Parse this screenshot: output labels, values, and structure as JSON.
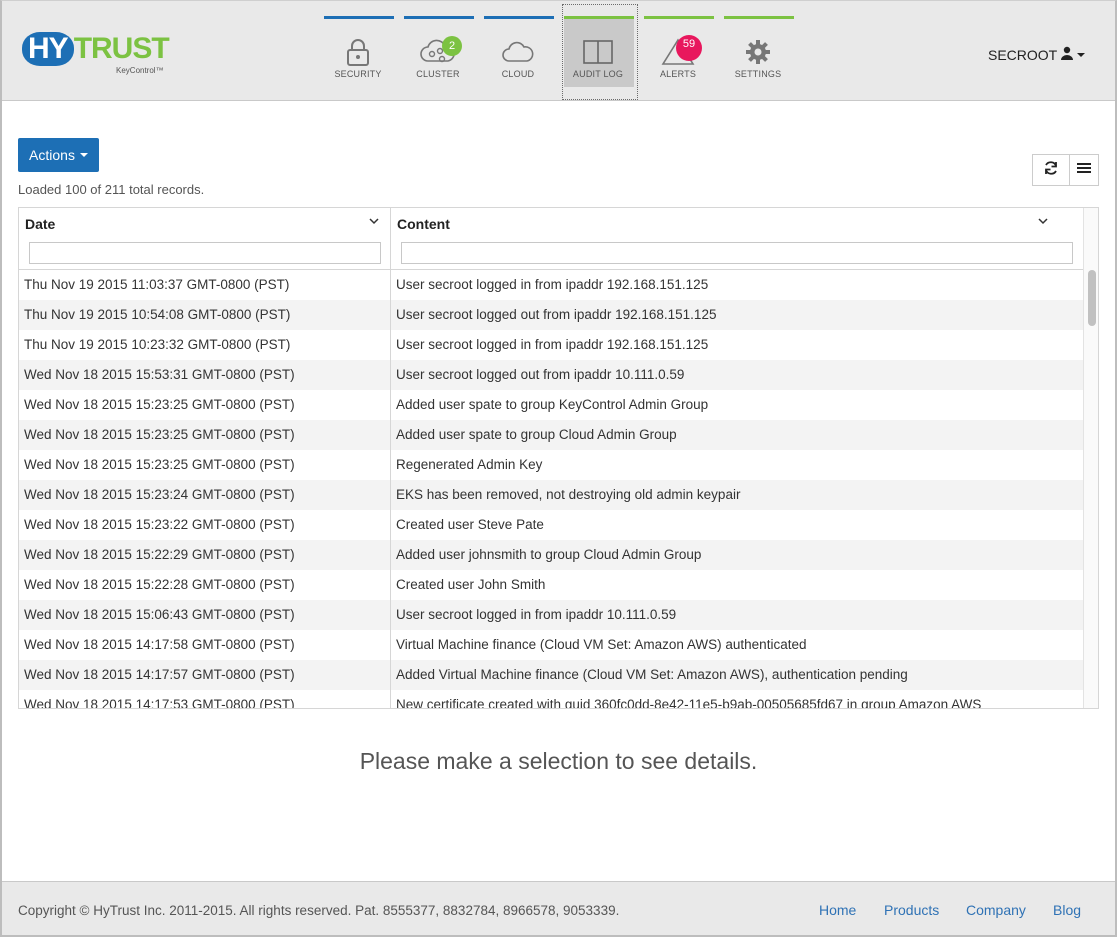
{
  "brand": {
    "main_a": "HY",
    "main_b": "TRUST",
    "sub": "KeyControl™"
  },
  "nav": {
    "items": [
      {
        "label": "SECURITY",
        "icon": "lock-icon",
        "bar_color": "#1d6fb5"
      },
      {
        "label": "CLUSTER",
        "icon": "cluster-icon",
        "bar_color": "#1d6fb5",
        "badge": "2",
        "badge_color": "#7cc242"
      },
      {
        "label": "CLOUD",
        "icon": "cloud-icon",
        "bar_color": "#1d6fb5"
      },
      {
        "label": "AUDIT LOG",
        "icon": "book-icon",
        "bar_color": "#7cc242",
        "active": true
      },
      {
        "label": "ALERTS",
        "icon": "alert-icon",
        "bar_color": "#7cc242",
        "badge": "59",
        "badge_color": "#e8175d"
      },
      {
        "label": "SETTINGS",
        "icon": "gear-icon",
        "bar_color": "#7cc242"
      }
    ]
  },
  "user": {
    "name": "SECROOT"
  },
  "toolbar": {
    "actions_label": "Actions",
    "record_count": "Loaded 100 of 211 total records."
  },
  "grid": {
    "columns": [
      {
        "title": "Date"
      },
      {
        "title": "Content"
      }
    ],
    "filters": {
      "date": "",
      "content": ""
    },
    "rows": [
      {
        "date": "Thu Nov 19 2015 11:03:37 GMT-0800 (PST)",
        "content": "User secroot logged in from ipaddr 192.168.151.125"
      },
      {
        "date": "Thu Nov 19 2015 10:54:08 GMT-0800 (PST)",
        "content": "User secroot logged out from ipaddr 192.168.151.125"
      },
      {
        "date": "Thu Nov 19 2015 10:23:32 GMT-0800 (PST)",
        "content": "User secroot logged in from ipaddr 192.168.151.125"
      },
      {
        "date": "Wed Nov 18 2015 15:53:31 GMT-0800 (PST)",
        "content": "User secroot logged out from ipaddr 10.111.0.59"
      },
      {
        "date": "Wed Nov 18 2015 15:23:25 GMT-0800 (PST)",
        "content": "Added user spate to group KeyControl Admin Group"
      },
      {
        "date": "Wed Nov 18 2015 15:23:25 GMT-0800 (PST)",
        "content": "Added user spate to group Cloud Admin Group"
      },
      {
        "date": "Wed Nov 18 2015 15:23:25 GMT-0800 (PST)",
        "content": "Regenerated Admin Key"
      },
      {
        "date": "Wed Nov 18 2015 15:23:24 GMT-0800 (PST)",
        "content": "EKS has been removed, not destroying old admin keypair"
      },
      {
        "date": "Wed Nov 18 2015 15:23:22 GMT-0800 (PST)",
        "content": "Created user Steve Pate"
      },
      {
        "date": "Wed Nov 18 2015 15:22:29 GMT-0800 (PST)",
        "content": "Added user johnsmith to group Cloud Admin Group"
      },
      {
        "date": "Wed Nov 18 2015 15:22:28 GMT-0800 (PST)",
        "content": "Created user John Smith"
      },
      {
        "date": "Wed Nov 18 2015 15:06:43 GMT-0800 (PST)",
        "content": "User secroot logged in from ipaddr 10.111.0.59"
      },
      {
        "date": "Wed Nov 18 2015 14:17:58 GMT-0800 (PST)",
        "content": "Virtual Machine finance (Cloud VM Set: Amazon AWS) authenticated"
      },
      {
        "date": "Wed Nov 18 2015 14:17:57 GMT-0800 (PST)",
        "content": "Added Virtual Machine finance (Cloud VM Set: Amazon AWS), authentication pending"
      },
      {
        "date": "Wed Nov 18 2015 14:17:53 GMT-0800 (PST)",
        "content": "New certificate created with guid 360fc0dd-8e42-11e5-b9ab-00505685fd67 in group Amazon AWS"
      }
    ]
  },
  "details": {
    "empty_message": "Please make a selection to see details."
  },
  "footer": {
    "copyright": "Copyright © HyTrust Inc. 2011-2015. All rights reserved. Pat. 8555377, 8832784, 8966578, 9053339.",
    "links": [
      "Home",
      "Products",
      "Company",
      "Blog"
    ]
  }
}
